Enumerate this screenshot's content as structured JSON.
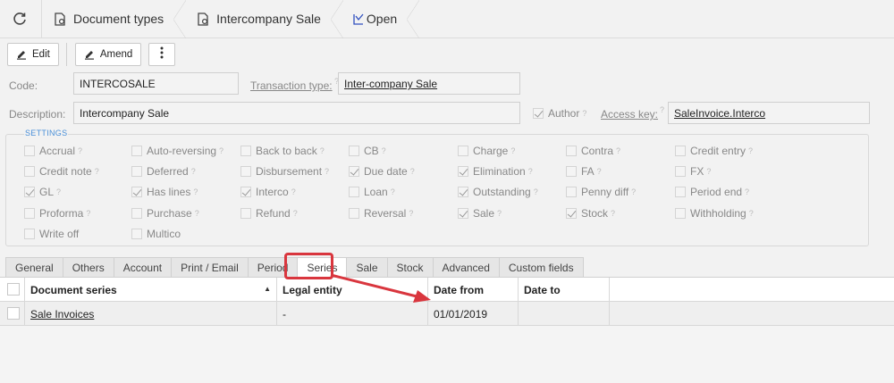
{
  "breadcrumb": {
    "items": [
      {
        "label": "Document types",
        "icon": "document-gear-icon"
      },
      {
        "label": "Intercompany Sale",
        "icon": "document-gear-icon"
      },
      {
        "label": "Open",
        "icon": "open-check-icon"
      }
    ]
  },
  "toolbar": {
    "edit_label": "Edit",
    "amend_label": "Amend"
  },
  "form": {
    "code_label": "Code:",
    "code_value": "INTERCOSALE",
    "transaction_type_label": "Transaction type:",
    "transaction_type_value": "Inter-company Sale",
    "description_label": "Description:",
    "description_value": "Intercompany Sale",
    "author_label": "Author",
    "author_checked": true,
    "access_key_label": "Access key:",
    "access_key_value": "SaleInvoice.Interco"
  },
  "settings": {
    "title": "SETTINGS",
    "rows": [
      [
        {
          "label": "Accrual",
          "checked": false
        },
        {
          "label": "Auto-reversing",
          "checked": false
        },
        {
          "label": "Back to back",
          "checked": false
        },
        {
          "label": "CB",
          "checked": false
        },
        {
          "label": "Charge",
          "checked": false
        },
        {
          "label": "Contra",
          "checked": false
        },
        {
          "label": "Credit entry",
          "checked": false
        }
      ],
      [
        {
          "label": "Credit note",
          "checked": false
        },
        {
          "label": "Deferred",
          "checked": false
        },
        {
          "label": "Disbursement",
          "checked": false
        },
        {
          "label": "Due date",
          "checked": true
        },
        {
          "label": "Elimination",
          "checked": true
        },
        {
          "label": "FA",
          "checked": false
        },
        {
          "label": "FX",
          "checked": false
        }
      ],
      [
        {
          "label": "GL",
          "checked": true
        },
        {
          "label": "Has lines",
          "checked": true
        },
        {
          "label": "Interco",
          "checked": true
        },
        {
          "label": "Loan",
          "checked": false
        },
        {
          "label": "Outstanding",
          "checked": true
        },
        {
          "label": "Penny diff",
          "checked": false
        },
        {
          "label": "Period end",
          "checked": false
        }
      ],
      [
        {
          "label": "Proforma",
          "checked": false
        },
        {
          "label": "Purchase",
          "checked": false
        },
        {
          "label": "Refund",
          "checked": false
        },
        {
          "label": "Reversal",
          "checked": false
        },
        {
          "label": "Sale",
          "checked": true
        },
        {
          "label": "Stock",
          "checked": true
        },
        {
          "label": "Withholding",
          "checked": false
        }
      ],
      [
        {
          "label": "Write off",
          "checked": false
        },
        {
          "label": "Multico",
          "checked": false
        }
      ]
    ]
  },
  "tabs": [
    "General",
    "Others",
    "Account",
    "Print / Email",
    "Period",
    "Series",
    "Sale",
    "Stock",
    "Advanced",
    "Custom fields"
  ],
  "active_tab": "Series",
  "grid": {
    "columns": [
      "Document series",
      "Legal entity",
      "Date from",
      "Date to"
    ],
    "rows": [
      {
        "document_series": "Sale Invoices",
        "legal_entity": "-",
        "date_from": "01/01/2019",
        "date_to": ""
      }
    ]
  },
  "annotation_color": "#d9363e"
}
